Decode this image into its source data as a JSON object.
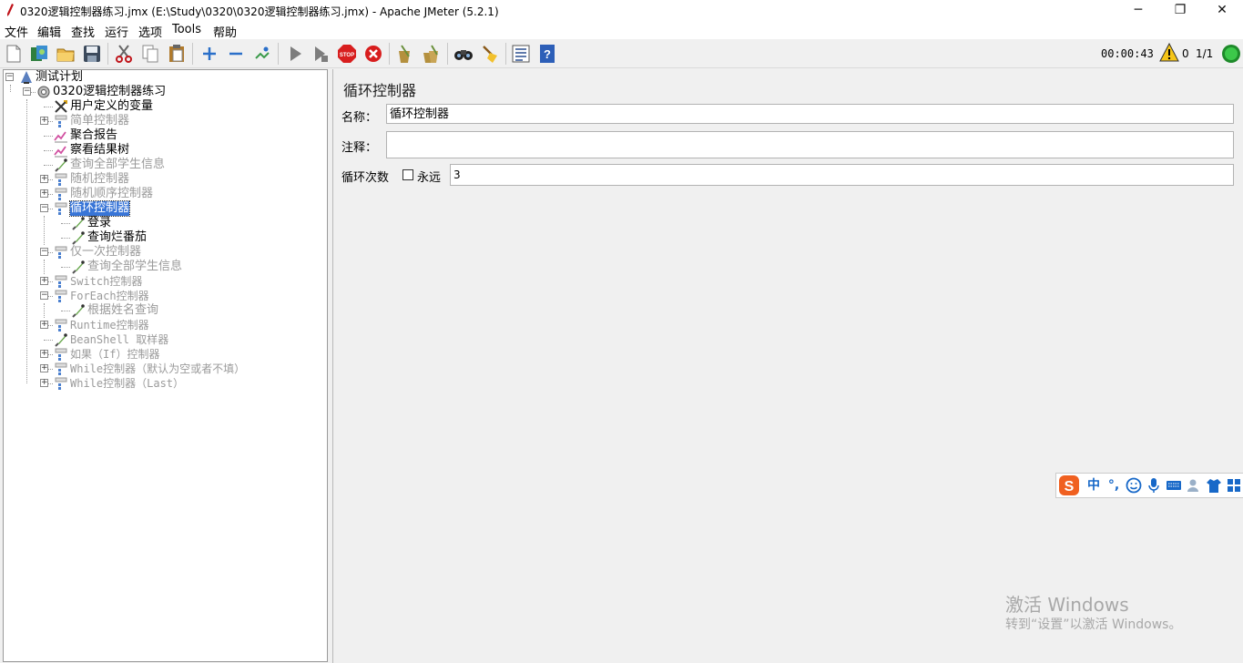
{
  "window": {
    "title": "0320逻辑控制器练习.jmx (E:\\Study\\0320\\0320逻辑控制器练习.jmx) - Apache JMeter (5.2.1)",
    "minimize": "─",
    "restore": "❐",
    "close": "✕"
  },
  "menu": [
    "文件",
    "编辑",
    "查找",
    "运行",
    "选项",
    "Tools",
    "帮助"
  ],
  "toolbar": {
    "icons": [
      "new-icon",
      "templates-icon",
      "open-icon",
      "save-icon",
      "cut-icon",
      "copy-icon",
      "paste-icon",
      "expand-icon",
      "collapse-icon",
      "toggle-icon",
      "start-icon",
      "start-no-pause-icon",
      "stop-icon",
      "shutdown-icon",
      "clear-icon",
      "clear-all-icon",
      "search-icon",
      "reset-search-icon",
      "function-helper-icon",
      "help-icon"
    ],
    "timer": "00:00:43",
    "warnings": "0",
    "threads": "1/1"
  },
  "tree": [
    {
      "label": "测试计划",
      "level": 0,
      "icon": "test-plan-icon",
      "enabled": true,
      "expanded": true
    },
    {
      "label": "0320逻辑控制器练习",
      "level": 1,
      "icon": "thread-group-icon",
      "enabled": true,
      "expanded": true
    },
    {
      "label": "用户定义的变量",
      "level": 2,
      "icon": "user-variables-icon",
      "enabled": true
    },
    {
      "label": "简单控制器",
      "level": 2,
      "icon": "controller-icon",
      "enabled": false,
      "expandable": true
    },
    {
      "label": "聚合报告",
      "level": 2,
      "icon": "listener-icon",
      "enabled": true
    },
    {
      "label": "察看结果树",
      "level": 2,
      "icon": "listener-icon",
      "enabled": true
    },
    {
      "label": "查询全部学生信息",
      "level": 2,
      "icon": "sampler-icon",
      "enabled": false
    },
    {
      "label": "随机控制器",
      "level": 2,
      "icon": "controller-icon",
      "enabled": false,
      "expandable": true
    },
    {
      "label": "随机顺序控制器",
      "level": 2,
      "icon": "controller-icon",
      "enabled": false,
      "expandable": true
    },
    {
      "label": "循环控制器",
      "level": 2,
      "icon": "controller-icon",
      "enabled": true,
      "expandable": true,
      "expanded": true,
      "selected": true
    },
    {
      "label": "登录",
      "level": 3,
      "icon": "sampler-icon",
      "enabled": true
    },
    {
      "label": "查询烂番茄",
      "level": 3,
      "icon": "sampler-icon",
      "enabled": true
    },
    {
      "label": "仅一次控制器",
      "level": 2,
      "icon": "controller-icon",
      "enabled": false,
      "expandable": true,
      "expanded": true
    },
    {
      "label": "查询全部学生信息",
      "level": 3,
      "icon": "sampler-icon",
      "enabled": false
    },
    {
      "label": "Switch控制器",
      "level": 2,
      "icon": "controller-icon",
      "enabled": false,
      "expandable": true
    },
    {
      "label": "ForEach控制器",
      "level": 2,
      "icon": "controller-icon",
      "enabled": false,
      "expandable": true,
      "expanded": true
    },
    {
      "label": "根据姓名查询",
      "level": 3,
      "icon": "sampler-icon",
      "enabled": false
    },
    {
      "label": "Runtime控制器",
      "level": 2,
      "icon": "controller-icon",
      "enabled": false,
      "expandable": true
    },
    {
      "label": "BeanShell 取样器",
      "level": 2,
      "icon": "sampler-icon",
      "enabled": false
    },
    {
      "label": "如果（If）控制器",
      "level": 2,
      "icon": "controller-icon",
      "enabled": false,
      "expandable": true
    },
    {
      "label": "While控制器（默认为空或者不填）",
      "level": 2,
      "icon": "controller-icon",
      "enabled": false,
      "expandable": true
    },
    {
      "label": "While控制器（Last）",
      "level": 2,
      "icon": "controller-icon",
      "enabled": false,
      "expandable": true
    }
  ],
  "detail": {
    "title": "循环控制器",
    "name_label": "名称：",
    "name_value": "循环控制器",
    "comment_label": "注释：",
    "comment_value": "",
    "loop_label": "循环次数",
    "forever_label": "永远",
    "forever_checked": false,
    "loop_value": "3"
  },
  "ime": {
    "mode": "中",
    "punct": "°,"
  },
  "watermark": {
    "line1": "激活 Windows",
    "line2": "转到“设置”以激活 Windows。"
  }
}
